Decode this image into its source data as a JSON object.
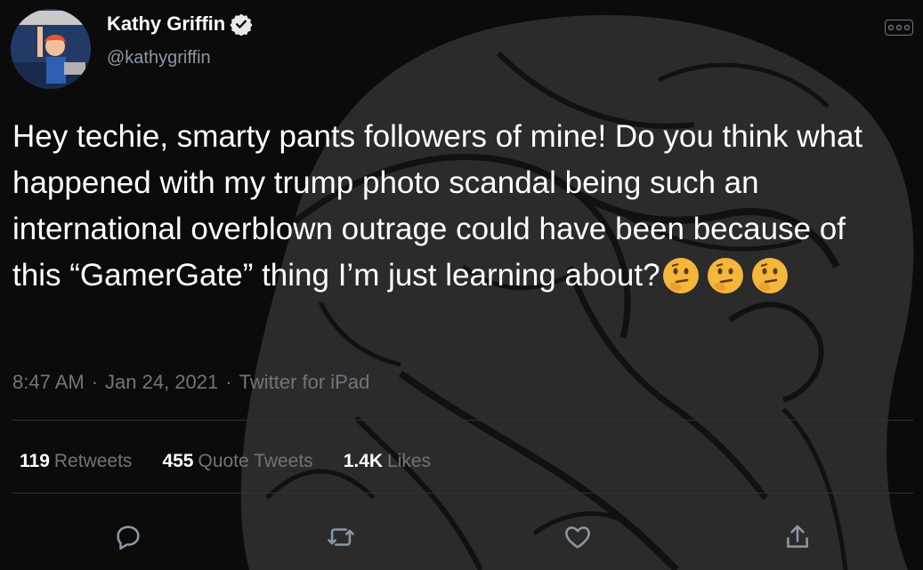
{
  "author": {
    "display_name": "Kathy Griffin",
    "handle": "@kathygriffin",
    "verified_icon": "verified-badge-icon"
  },
  "tweet": {
    "text": "Hey techie, smarty pants followers of mine! Do you think what happened with my trump photo scandal being such an international overblown outrage could have been because of this “GamerGate” thing I’m just learning about?",
    "emojis": [
      "thinking-face-emoji",
      "thinking-face-emoji",
      "thinking-face-emoji"
    ]
  },
  "meta": {
    "time": "8:47 AM",
    "separator": "·",
    "date": "Jan 24, 2021",
    "source": "Twitter for iPad"
  },
  "stats": {
    "retweets": {
      "count": "119",
      "label": "Retweets"
    },
    "quote_tweets": {
      "count": "455",
      "label": "Quote Tweets"
    },
    "likes": {
      "count": "1.4K",
      "label": "Likes"
    }
  },
  "actions": [
    "reply-icon",
    "retweet-icon",
    "like-icon",
    "share-icon"
  ],
  "colors": {
    "background": "#0b0b0b",
    "text": "#ffffff",
    "secondary_text": "#6e767d",
    "divider": "#2f3336"
  }
}
